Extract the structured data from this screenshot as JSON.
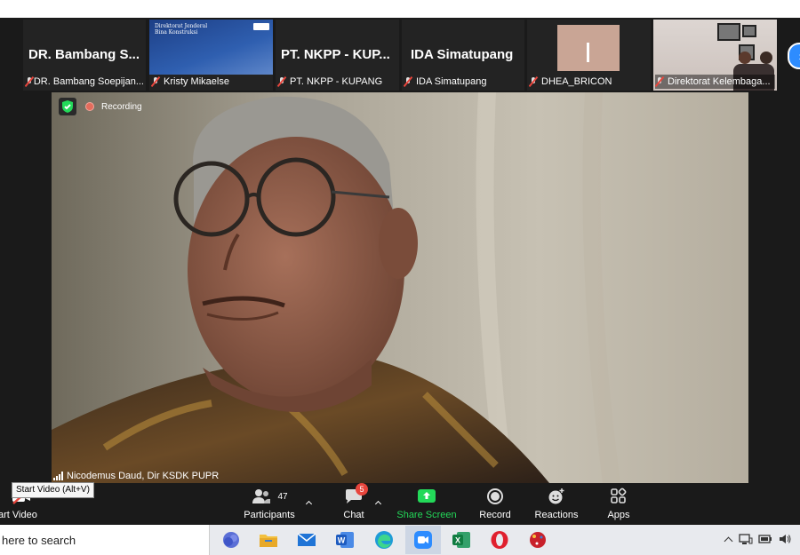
{
  "participants_strip": [
    {
      "display": "DR. Bambang S...",
      "name": "DR. Bambang Soepijan...",
      "kind": "text"
    },
    {
      "display": "",
      "name": "Kristy Mikaelse",
      "kind": "slide",
      "slide_title": "Direktorat Jenderal\nBina Konstruksi"
    },
    {
      "display": "PT. NKPP - KUP...",
      "name": "PT. NKPP - KUPANG",
      "kind": "text"
    },
    {
      "display": "IDA Simatupang",
      "name": "IDA Simatupang",
      "kind": "text"
    },
    {
      "display": "",
      "name": "DHEA_BRICON",
      "kind": "pale"
    },
    {
      "display": "",
      "name": "Direktorat Kelembaga...",
      "kind": "photo"
    }
  ],
  "main_video": {
    "recording_label": "Recording",
    "speaker_name": "Nicodemus Daud, Dir KSDK PUPR"
  },
  "tooltip": "Start Video (Alt+V)",
  "toolbar": {
    "start_video_label": "art Video",
    "participants_label": "Participants",
    "participants_count": "47",
    "chat_label": "Chat",
    "chat_badge": "5",
    "share_label": "Share Screen",
    "record_label": "Record",
    "reactions_label": "Reactions",
    "apps_label": "Apps"
  },
  "taskbar": {
    "search_text": "here to search",
    "apps": [
      "teams-icon",
      "file-explorer-icon",
      "mail-icon",
      "word-icon",
      "edge-icon",
      "zoom-icon",
      "excel-icon",
      "opera-icon",
      "app-icon"
    ]
  },
  "colors": {
    "zoom_blue": "#2d8cff",
    "share_green": "#23d959",
    "mute_red": "#e8453c"
  }
}
